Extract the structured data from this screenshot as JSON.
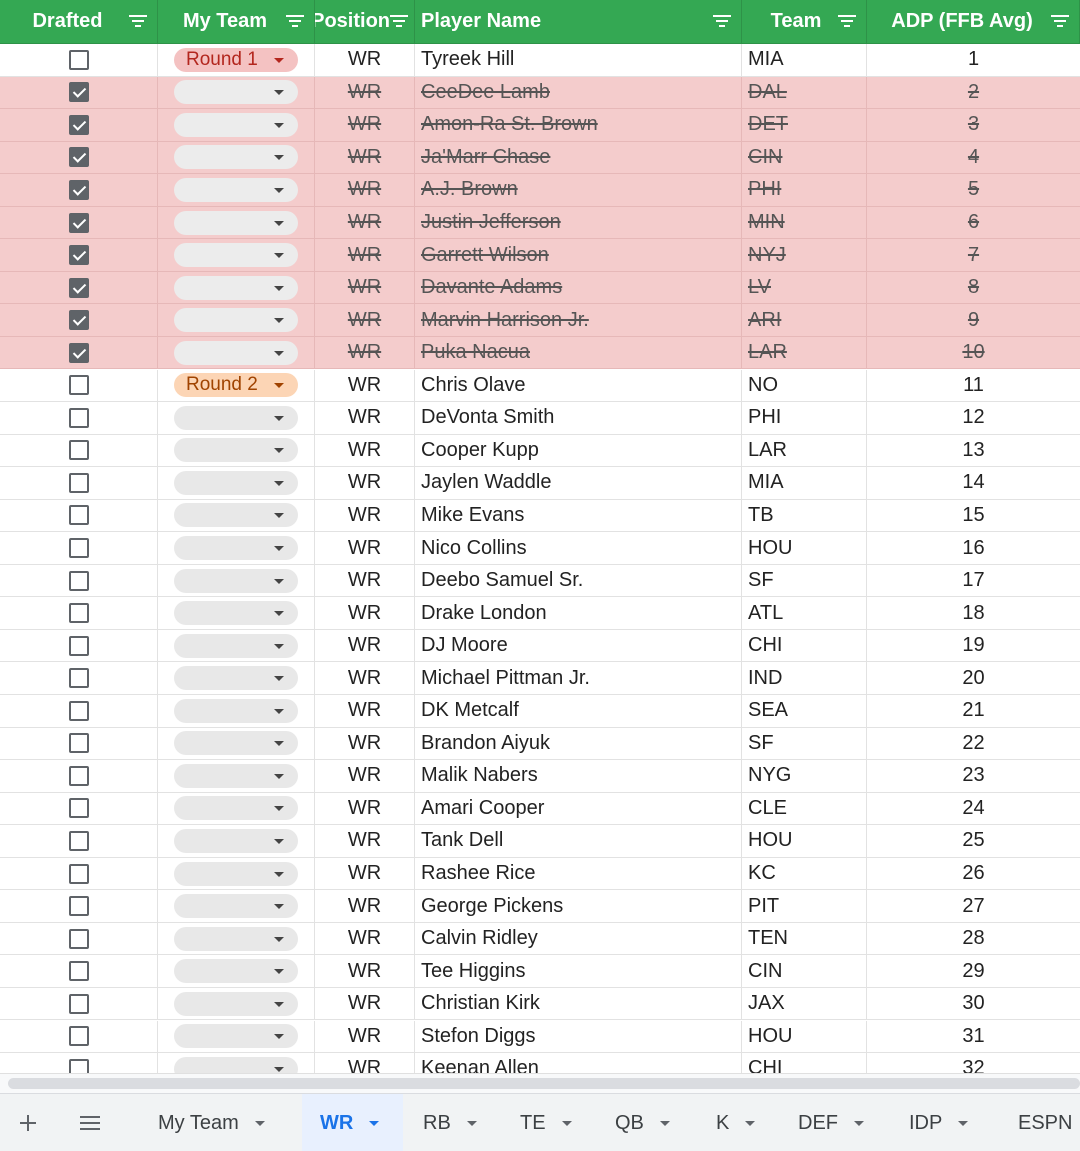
{
  "columns": [
    {
      "label": "Drafted"
    },
    {
      "label": "My Team"
    },
    {
      "label": "Position"
    },
    {
      "label": "Player Name"
    },
    {
      "label": "Team"
    },
    {
      "label": "ADP (FFB Avg)"
    }
  ],
  "rows": [
    {
      "drafted": false,
      "round": "Round 1",
      "position": "WR",
      "player": "Tyreek Hill",
      "team": "MIA",
      "adp": "1"
    },
    {
      "drafted": true,
      "round": "",
      "position": "WR",
      "player": "CeeDee Lamb",
      "team": "DAL",
      "adp": "2"
    },
    {
      "drafted": true,
      "round": "",
      "position": "WR",
      "player": "Amon-Ra St. Brown",
      "team": "DET",
      "adp": "3"
    },
    {
      "drafted": true,
      "round": "",
      "position": "WR",
      "player": "Ja'Marr Chase",
      "team": "CIN",
      "adp": "4"
    },
    {
      "drafted": true,
      "round": "",
      "position": "WR",
      "player": "A.J. Brown",
      "team": "PHI",
      "adp": "5"
    },
    {
      "drafted": true,
      "round": "",
      "position": "WR",
      "player": "Justin Jefferson",
      "team": "MIN",
      "adp": "6"
    },
    {
      "drafted": true,
      "round": "",
      "position": "WR",
      "player": "Garrett Wilson",
      "team": "NYJ",
      "adp": "7"
    },
    {
      "drafted": true,
      "round": "",
      "position": "WR",
      "player": "Davante Adams",
      "team": "LV",
      "adp": "8"
    },
    {
      "drafted": true,
      "round": "",
      "position": "WR",
      "player": "Marvin Harrison Jr.",
      "team": "ARI",
      "adp": "9"
    },
    {
      "drafted": true,
      "round": "",
      "position": "WR",
      "player": "Puka Nacua",
      "team": "LAR",
      "adp": "10"
    },
    {
      "drafted": false,
      "round": "Round 2",
      "position": "WR",
      "player": "Chris Olave",
      "team": "NO",
      "adp": "11"
    },
    {
      "drafted": false,
      "round": "",
      "position": "WR",
      "player": "DeVonta Smith",
      "team": "PHI",
      "adp": "12"
    },
    {
      "drafted": false,
      "round": "",
      "position": "WR",
      "player": "Cooper Kupp",
      "team": "LAR",
      "adp": "13"
    },
    {
      "drafted": false,
      "round": "",
      "position": "WR",
      "player": "Jaylen Waddle",
      "team": "MIA",
      "adp": "14"
    },
    {
      "drafted": false,
      "round": "",
      "position": "WR",
      "player": "Mike Evans",
      "team": "TB",
      "adp": "15"
    },
    {
      "drafted": false,
      "round": "",
      "position": "WR",
      "player": "Nico Collins",
      "team": "HOU",
      "adp": "16"
    },
    {
      "drafted": false,
      "round": "",
      "position": "WR",
      "player": "Deebo Samuel Sr.",
      "team": "SF",
      "adp": "17"
    },
    {
      "drafted": false,
      "round": "",
      "position": "WR",
      "player": "Drake London",
      "team": "ATL",
      "adp": "18"
    },
    {
      "drafted": false,
      "round": "",
      "position": "WR",
      "player": "DJ Moore",
      "team": "CHI",
      "adp": "19"
    },
    {
      "drafted": false,
      "round": "",
      "position": "WR",
      "player": "Michael Pittman Jr.",
      "team": "IND",
      "adp": "20"
    },
    {
      "drafted": false,
      "round": "",
      "position": "WR",
      "player": "DK Metcalf",
      "team": "SEA",
      "adp": "21"
    },
    {
      "drafted": false,
      "round": "",
      "position": "WR",
      "player": "Brandon Aiyuk",
      "team": "SF",
      "adp": "22"
    },
    {
      "drafted": false,
      "round": "",
      "position": "WR",
      "player": "Malik Nabers",
      "team": "NYG",
      "adp": "23"
    },
    {
      "drafted": false,
      "round": "",
      "position": "WR",
      "player": "Amari Cooper",
      "team": "CLE",
      "adp": "24"
    },
    {
      "drafted": false,
      "round": "",
      "position": "WR",
      "player": "Tank Dell",
      "team": "HOU",
      "adp": "25"
    },
    {
      "drafted": false,
      "round": "",
      "position": "WR",
      "player": "Rashee Rice",
      "team": "KC",
      "adp": "26"
    },
    {
      "drafted": false,
      "round": "",
      "position": "WR",
      "player": "George Pickens",
      "team": "PIT",
      "adp": "27"
    },
    {
      "drafted": false,
      "round": "",
      "position": "WR",
      "player": "Calvin Ridley",
      "team": "TEN",
      "adp": "28"
    },
    {
      "drafted": false,
      "round": "",
      "position": "WR",
      "player": "Tee Higgins",
      "team": "CIN",
      "adp": "29"
    },
    {
      "drafted": false,
      "round": "",
      "position": "WR",
      "player": "Christian Kirk",
      "team": "JAX",
      "adp": "30"
    },
    {
      "drafted": false,
      "round": "",
      "position": "WR",
      "player": "Stefon Diggs",
      "team": "HOU",
      "adp": "31"
    },
    {
      "drafted": false,
      "round": "",
      "position": "WR",
      "player": "Keenan Allen",
      "team": "CHI",
      "adp": "32"
    }
  ],
  "tabs": [
    {
      "label": "My Team",
      "active": false,
      "dropdown": true
    },
    {
      "label": "WR",
      "active": true,
      "dropdown": true
    },
    {
      "label": "RB",
      "active": false,
      "dropdown": true
    },
    {
      "label": "TE",
      "active": false,
      "dropdown": true
    },
    {
      "label": "QB",
      "active": false,
      "dropdown": true
    },
    {
      "label": "K",
      "active": false,
      "dropdown": true
    },
    {
      "label": "DEF",
      "active": false,
      "dropdown": true
    },
    {
      "label": "IDP",
      "active": false,
      "dropdown": true
    },
    {
      "label": "ESPN",
      "active": false,
      "dropdown": false
    }
  ],
  "icons": {
    "add_sheet": "plus-icon",
    "all_sheets": "menu-icon",
    "filter": "filter-icon",
    "checkbox": "checkbox-icon",
    "dropdown": "chevron-down-icon"
  },
  "colors": {
    "header_bg": "#34a853",
    "drafted_row_bg": "#f4cccc",
    "round1_chip": "#f4c2c2",
    "round2_chip": "#fcd5b5",
    "active_tab": "#1a73e8"
  }
}
